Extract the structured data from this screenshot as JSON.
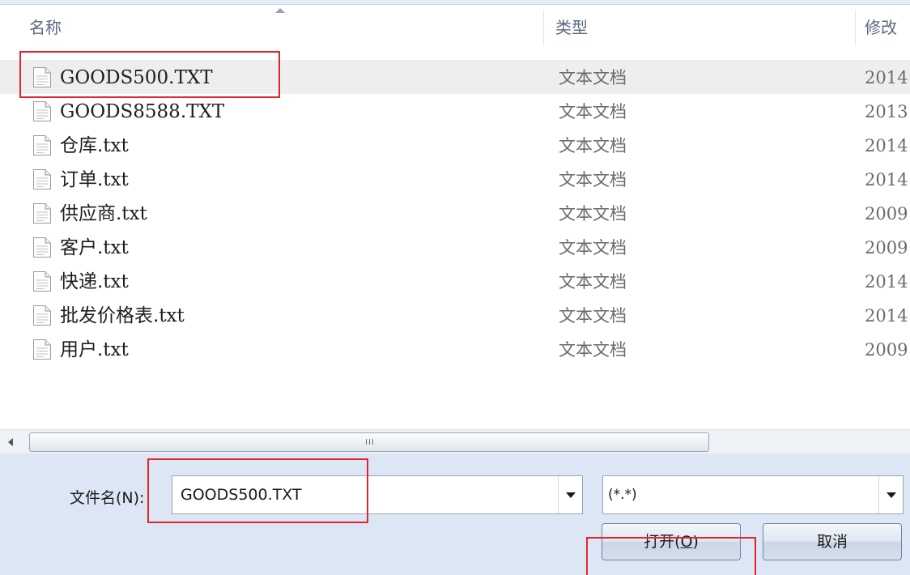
{
  "columns": {
    "name": "名称",
    "type": "类型",
    "date": "修改"
  },
  "files": [
    {
      "name": "GOODS500.TXT",
      "type": "文本文档",
      "date": "2014",
      "selected": true
    },
    {
      "name": "GOODS8588.TXT",
      "type": "文本文档",
      "date": "2013",
      "selected": false
    },
    {
      "name": "仓库.txt",
      "type": "文本文档",
      "date": "2014",
      "selected": false
    },
    {
      "name": "订单.txt",
      "type": "文本文档",
      "date": "2014",
      "selected": false
    },
    {
      "name": "供应商.txt",
      "type": "文本文档",
      "date": "2009",
      "selected": false
    },
    {
      "name": "客户.txt",
      "type": "文本文档",
      "date": "2009",
      "selected": false
    },
    {
      "name": "快递.txt",
      "type": "文本文档",
      "date": "2014",
      "selected": false
    },
    {
      "name": "批发价格表.txt",
      "type": "文本文档",
      "date": "2014",
      "selected": false
    },
    {
      "name": "用户.txt",
      "type": "文本文档",
      "date": "2009",
      "selected": false
    }
  ],
  "scrollbar": {
    "grip": "III"
  },
  "filename": {
    "label_prefix": "文件名(",
    "label_accel": "N",
    "label_suffix": "):",
    "value": "GOODS500.TXT"
  },
  "filter": {
    "value": "(*.*)"
  },
  "buttons": {
    "open_prefix": "打开(",
    "open_accel": "O",
    "open_suffix": ")",
    "cancel": "取消"
  },
  "icons": {
    "file": "text-file-icon",
    "sort": "sort-ascending-icon",
    "dropdown": "chevron-down-icon",
    "scroll_left": "scroll-left-icon"
  },
  "colors": {
    "annotation": "#e0262c",
    "panel": "#dce6f4",
    "selected_row": "#eeeeef"
  }
}
